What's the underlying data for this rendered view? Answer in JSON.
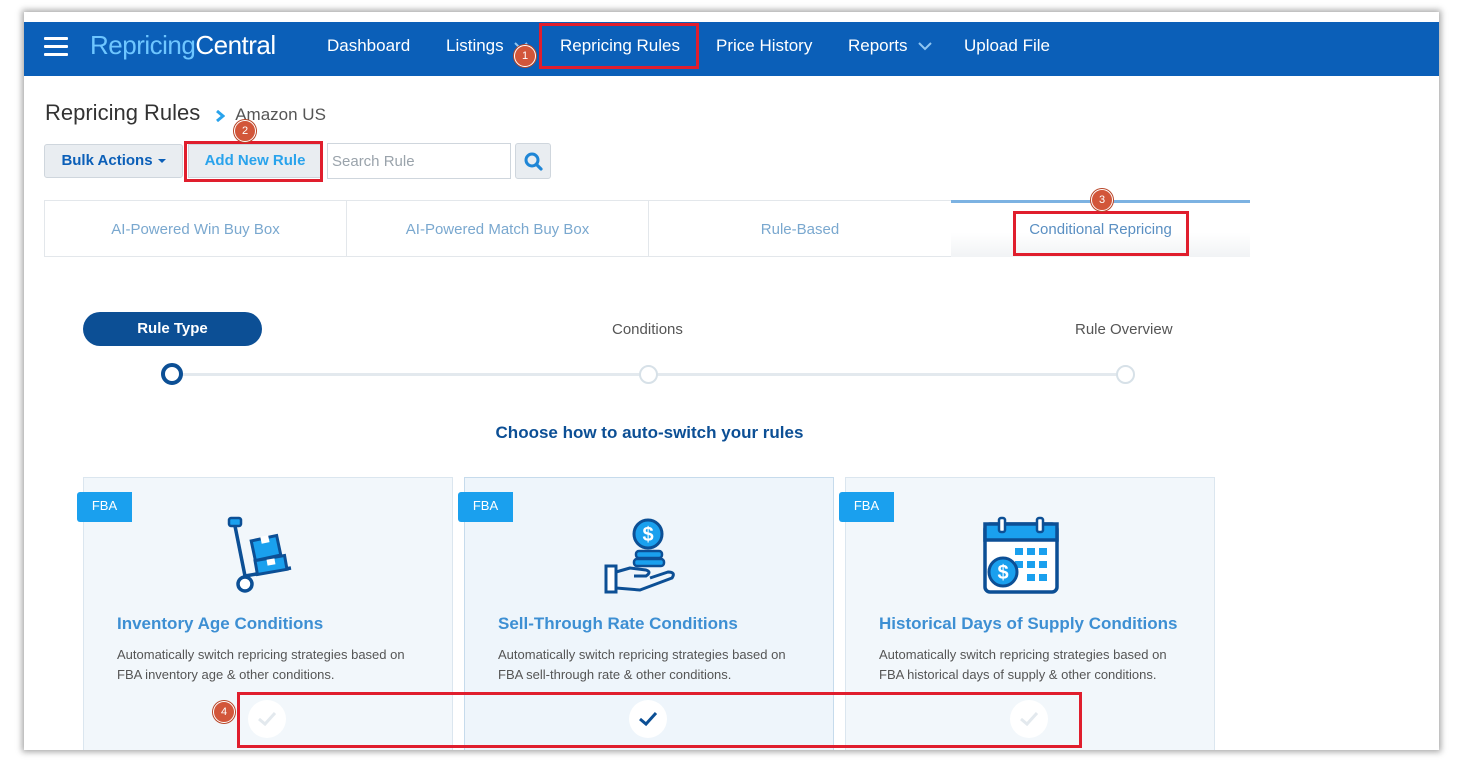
{
  "navbar": {
    "logo_part1": "Repricing",
    "logo_part2": "Central",
    "items": [
      {
        "label": "Dashboard"
      },
      {
        "label": "Listings"
      },
      {
        "label": "Repricing Rules"
      },
      {
        "label": "Price History"
      },
      {
        "label": "Reports"
      },
      {
        "label": "Upload File"
      }
    ]
  },
  "breadcrumb": {
    "title": "Repricing Rules",
    "marketplace": "Amazon US"
  },
  "toolbar": {
    "bulk_actions": "Bulk Actions",
    "add_new_rule": "Add New Rule",
    "search_placeholder": "Search Rule"
  },
  "tabs": [
    {
      "label": "AI-Powered Win Buy Box"
    },
    {
      "label": "AI-Powered Match Buy Box"
    },
    {
      "label": "Rule-Based"
    },
    {
      "label": "Conditional Repricing",
      "active": true
    }
  ],
  "wizard": {
    "steps": [
      {
        "label": "Rule Type",
        "active": true
      },
      {
        "label": "Conditions"
      },
      {
        "label": "Rule Overview"
      }
    ],
    "heading": "Choose how to auto-switch your rules"
  },
  "cards": [
    {
      "badge": "FBA",
      "icon": "hand-truck-boxes-icon",
      "title": "Inventory Age Conditions",
      "description": "Automatically switch repricing strategies based on FBA inventory age & other conditions.",
      "selected": false
    },
    {
      "badge": "FBA",
      "icon": "hand-coins-icon",
      "title": "Sell-Through Rate Conditions",
      "description": "Automatically switch repricing strategies based on FBA sell-through rate & other conditions.",
      "selected": true
    },
    {
      "badge": "FBA",
      "icon": "calendar-dollar-icon",
      "title": "Historical Days of Supply Conditions",
      "description": "Automatically switch repricing strategies based on FBA historical days of supply & other conditions.",
      "selected": false
    }
  ],
  "annotations": {
    "step1": "1",
    "step2": "2",
    "step3": "3",
    "step4": "4"
  },
  "colors": {
    "navbar": "#0b5fb8",
    "primary_dark": "#0c4f95",
    "accent_light": "#1aa0ee",
    "highlight_red": "#e01e2d",
    "badge_orange": "#d2563a"
  }
}
